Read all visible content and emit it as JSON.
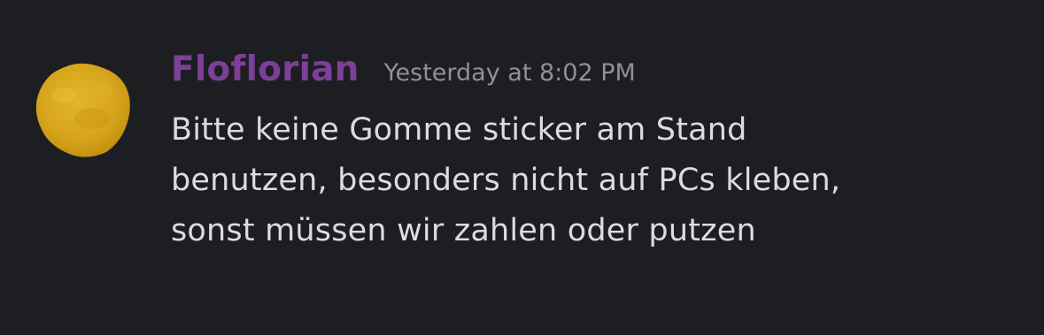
{
  "message": {
    "author": "Floflorian",
    "timestamp": "Yesterday at 8:02 PM",
    "content_lines": [
      "Bitte keine Gomme sticker am Stand",
      "benutzen, besonders nicht auf PCs kleben,",
      "sonst müssen wir zahlen oder putzen"
    ]
  },
  "colors": {
    "background": "#1d1e22",
    "author": "#7d3f98",
    "timestamp": "#8f909a",
    "text": "#dbdbe0",
    "avatar": "#d8a81c"
  },
  "avatar": {
    "icon": "yellow-blob-avatar-icon"
  }
}
